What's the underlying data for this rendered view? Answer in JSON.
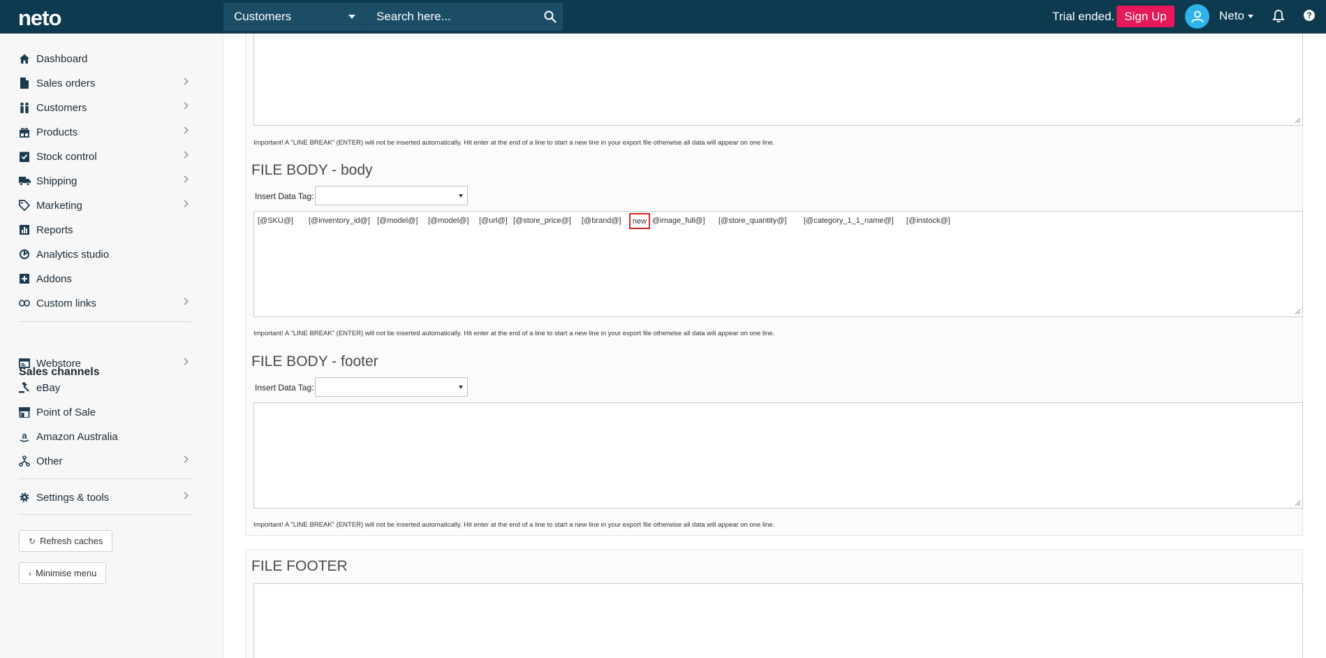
{
  "header": {
    "logo": "neto",
    "search_scope": "Customers",
    "search_placeholder": "Search here...",
    "trial_text": "Trial ended.",
    "signup_label": "Sign Up",
    "user_name": "Neto"
  },
  "sidebar": {
    "items": [
      {
        "label": "Dashboard",
        "icon": "home-icon"
      },
      {
        "label": "Sales orders",
        "icon": "document-icon"
      },
      {
        "label": "Customers",
        "icon": "people-icon"
      },
      {
        "label": "Products",
        "icon": "gift-icon"
      },
      {
        "label": "Stock control",
        "icon": "clipboard-check-icon"
      },
      {
        "label": "Shipping",
        "icon": "truck-icon"
      },
      {
        "label": "Marketing",
        "icon": "tag-icon"
      },
      {
        "label": "Reports",
        "icon": "bar-chart-icon"
      },
      {
        "label": "Analytics studio",
        "icon": "analytics-icon"
      },
      {
        "label": "Addons",
        "icon": "plus-square-icon"
      },
      {
        "label": "Custom links",
        "icon": "link-icon"
      }
    ],
    "sales_channels_title": "Sales channels",
    "channels": [
      {
        "label": "Webstore",
        "icon": "browser-icon"
      },
      {
        "label": "eBay",
        "icon": "gavel-icon"
      },
      {
        "label": "Point of Sale",
        "icon": "store-icon"
      },
      {
        "label": "Amazon Australia",
        "icon": "amazon-icon"
      },
      {
        "label": "Other",
        "icon": "network-icon"
      }
    ],
    "settings_label": "Settings & tools",
    "refresh_label": "Refresh caches",
    "minimise_label": "Minimise menu"
  },
  "main": {
    "line_break_note": "Important! A \"LINE BREAK\" (ENTER) will not be inserted automatically. Hit enter at the end of a line to start a new line in your export file otherwise all data will appear on one line.",
    "body_heading": "FILE BODY - body",
    "footer_heading": "FILE BODY - footer",
    "file_footer_heading": "FILE FOOTER",
    "insert_tag_label": "Insert Data Tag:",
    "body_tokens": [
      "[@SKU@]",
      "[@inventory_id@]",
      "[@model@]",
      "[@model@]",
      "[@url@]",
      "[@store_price@]",
      "[@brand@]",
      "new",
      "@image_full@]",
      "[@store_quantity@]",
      "[@category_1_1_name@]",
      "[@instock@]"
    ]
  },
  "colors": {
    "topbar": "#0d3a4f",
    "signup": "#e5185a",
    "avatar": "#2fb3e8",
    "highlight": "#e02020"
  }
}
